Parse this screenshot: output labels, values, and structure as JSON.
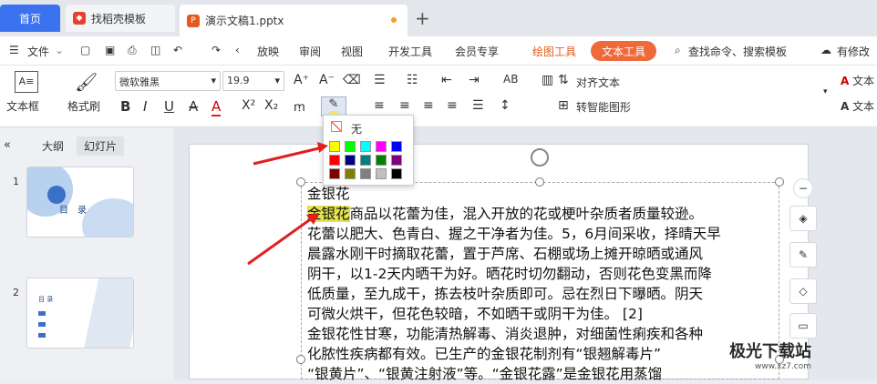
{
  "tabs": {
    "home": "首页",
    "template": "找稻壳模板",
    "doc": "演示文稿1.pptx"
  },
  "menu": {
    "file": "文件",
    "items": [
      "放映",
      "审阅",
      "视图",
      "开发工具",
      "会员专享"
    ],
    "draw_tools": "绘图工具",
    "text_tools": "文本工具",
    "search": "查找命令、搜索模板",
    "revision": "有修改"
  },
  "toolbar": {
    "textbox": "文本框",
    "format_painter": "格式刷",
    "font": "微软雅黑",
    "size": "19.9",
    "align_text": "对齐文本",
    "smart_art": "转智能图形",
    "text_side_1": "文本",
    "text_side_2": "文本"
  },
  "sidebar": {
    "outline": "大纲",
    "slides": "幻灯片",
    "slide_numbers": [
      "1",
      "2"
    ],
    "thumb1_title": "目　录",
    "thumb2_title": "目 录"
  },
  "popup": {
    "none": "无",
    "colors": [
      "#ffff00",
      "#00ff00",
      "#00ffff",
      "#ff00ff",
      "#0000ff",
      "#ff0000",
      "#000080",
      "#008080",
      "#008000",
      "#800080",
      "#800000",
      "#808000",
      "#808080",
      "#c0c0c0",
      "#000000"
    ]
  },
  "content": {
    "lines": [
      "金银花",
      "金银花商品以花蕾为佳，混入开放的花或梗叶杂质者质量较逊。",
      "花蕾以肥大、色青白、握之干净者为佳。5，6月间采收，择晴天早",
      "晨露水刚干时摘取花蕾，置于芦席、石棚或场上摊开晾晒或通风",
      "阴干，以1-2天内晒干为好。晒花时切勿翻动，否则花色变黑而降",
      "低质量，至九成干，拣去枝叶杂质即可。忌在烈日下曝晒。阴天",
      "可微火烘干，但花色较暗，不如晒干或阴干为佳。 [2]",
      "金银花性甘寒，功能清热解毒、消炎退肿，对细菌性痢疾和各种",
      "化脓性疾病都有效。已生产的金银花制剂有“银翘解毒片”",
      "“银黄片”、“银黄注射液”等。“金银花露”是金银花用蒸馏"
    ],
    "highlight": "金银花",
    "line2_rest": "商品以花蕾为佳，混入开放的花或梗叶杂质者质量较逊。"
  },
  "watermark": {
    "brand": "极光下载站",
    "url": "www.xz7.com"
  }
}
